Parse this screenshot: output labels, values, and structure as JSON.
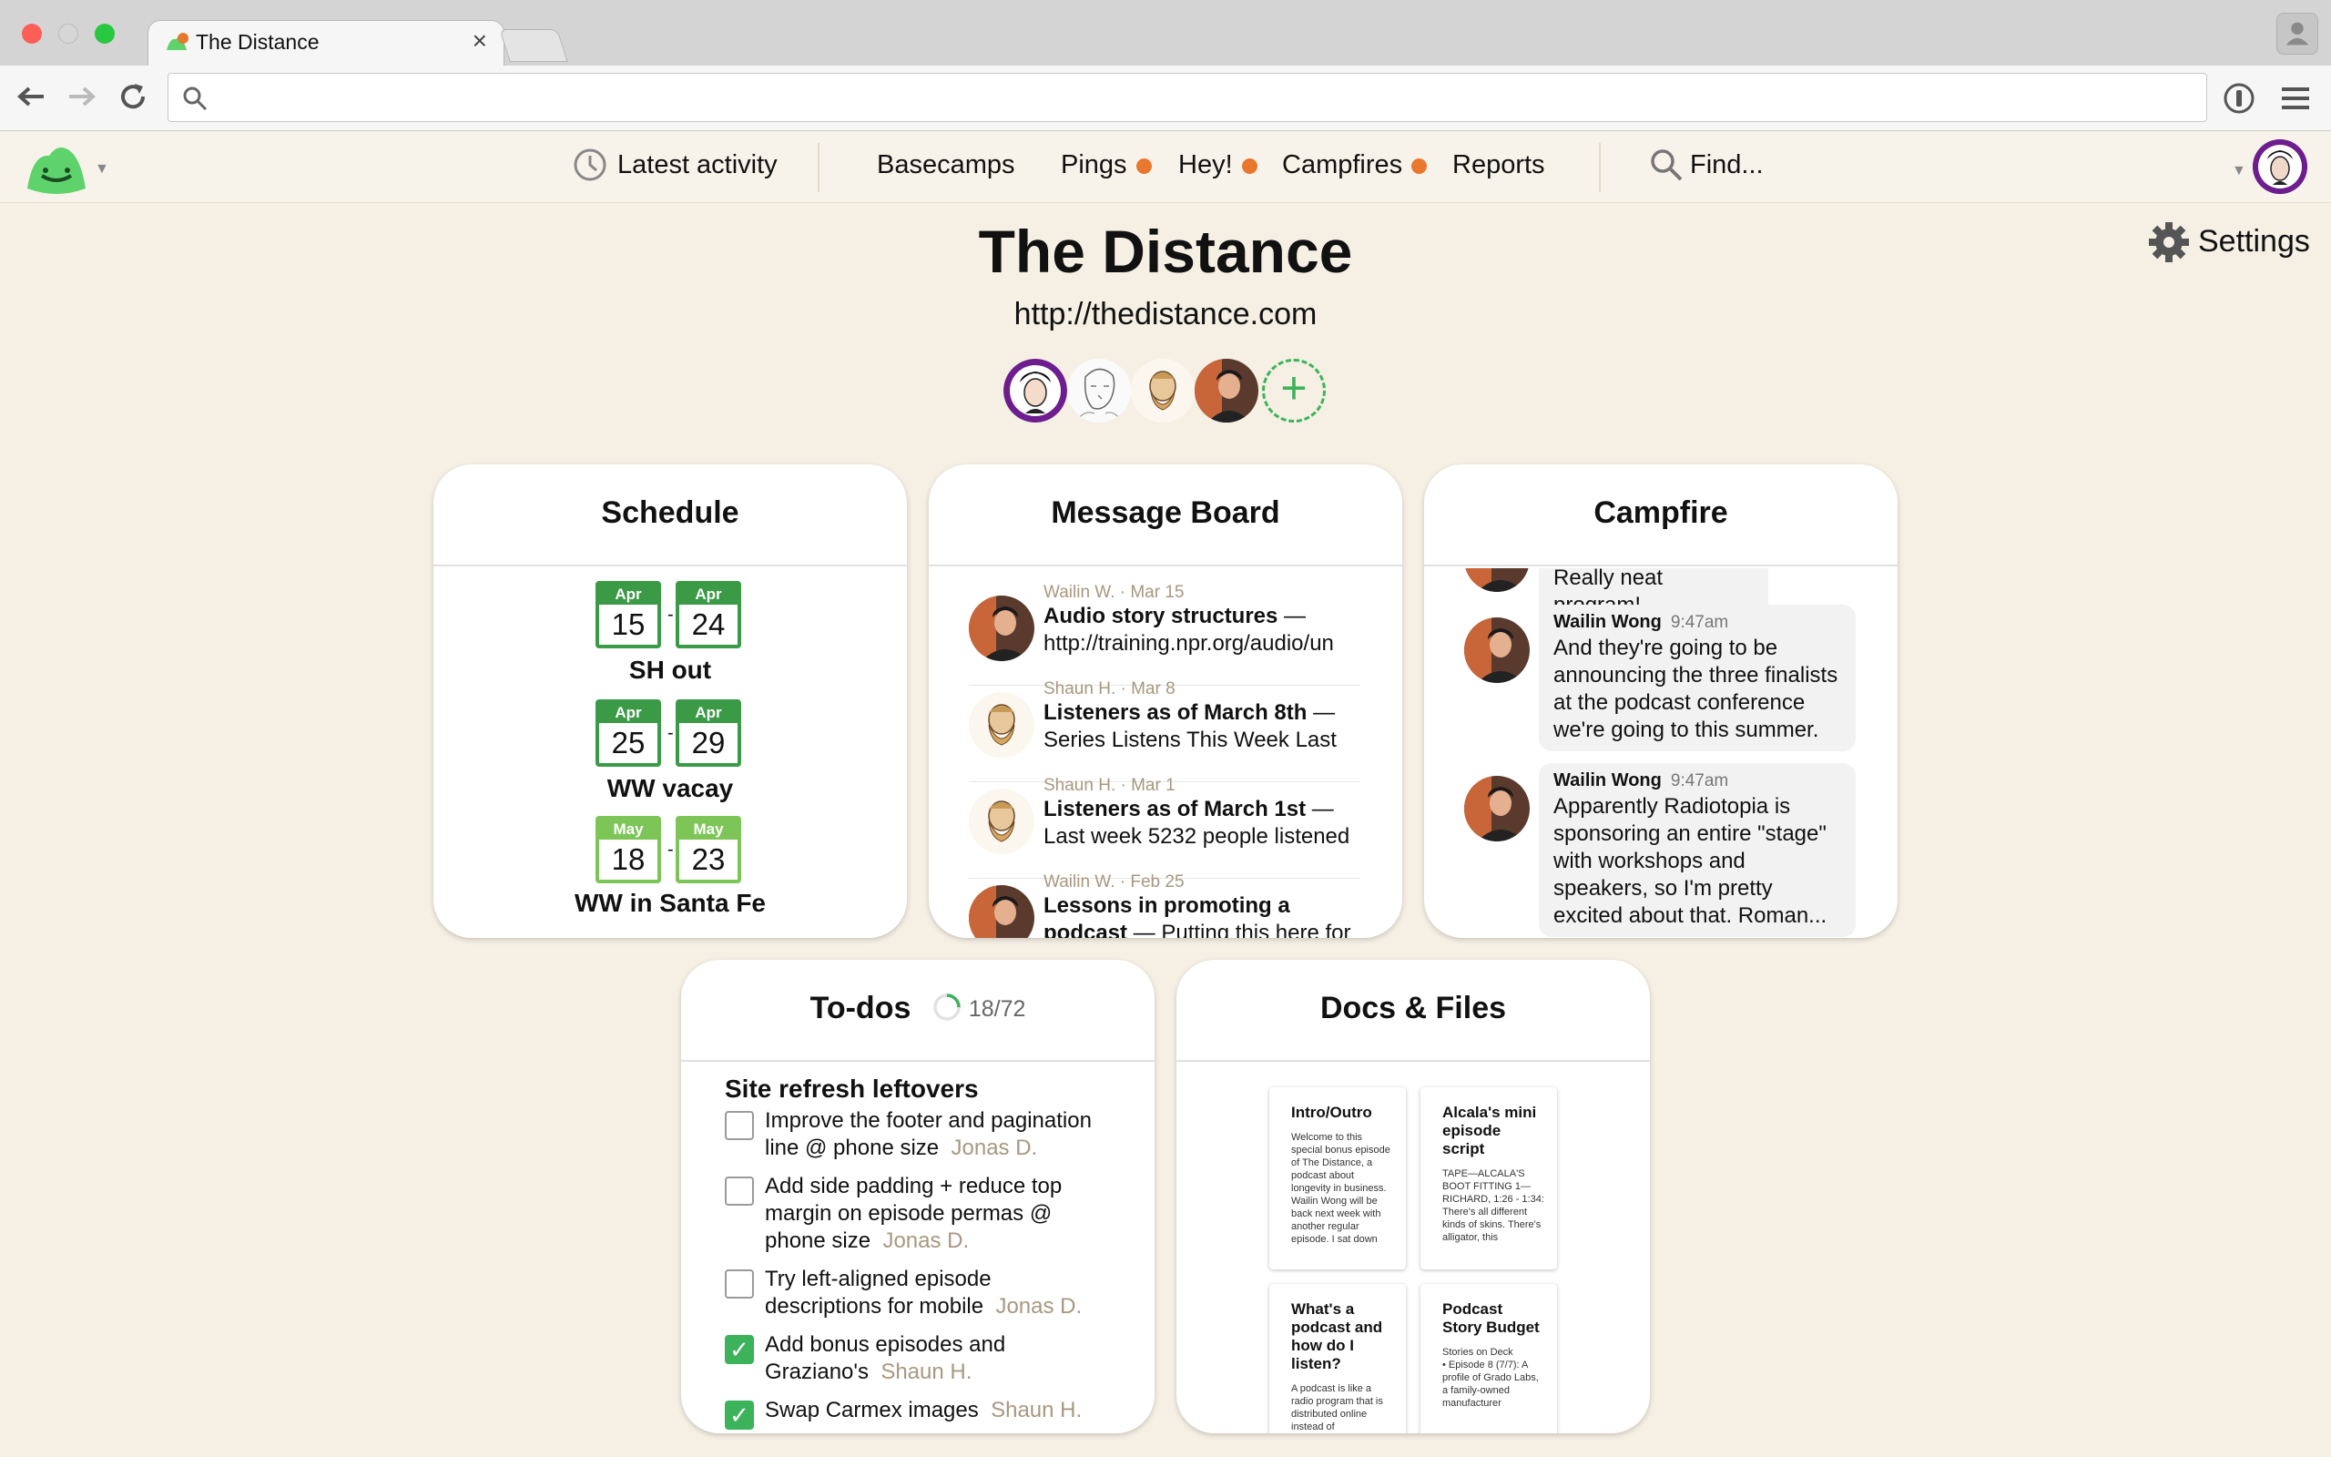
{
  "browser": {
    "tab_title": "The Distance",
    "tab_close": "×",
    "omnibox_value": ""
  },
  "nav": {
    "latest_activity": "Latest activity",
    "basecamps": "Basecamps",
    "pings": "Pings",
    "hey": "Hey!",
    "campfires": "Campfires",
    "reports": "Reports",
    "find": "Find...",
    "notification_dot_color": "#e8782e"
  },
  "settings_label": "Settings",
  "project": {
    "title": "The Distance",
    "url": "http://thedistance.com",
    "add_person": "+"
  },
  "schedule": {
    "title": "Schedule",
    "events": [
      {
        "name": "SH out",
        "start": {
          "month": "Apr",
          "day": "15"
        },
        "end": {
          "month": "Apr",
          "day": "24"
        }
      },
      {
        "name": "WW vacay",
        "start": {
          "month": "Apr",
          "day": "25"
        },
        "end": {
          "month": "Apr",
          "day": "29"
        }
      },
      {
        "name": "WW in Santa Fe",
        "start": {
          "month": "May",
          "day": "18"
        },
        "end": {
          "month": "May",
          "day": "23"
        }
      }
    ],
    "dash": "-"
  },
  "message_board": {
    "title": "Message Board",
    "messages": [
      {
        "meta": "Wailin W. · Mar 15",
        "title": "Audio story structures",
        "sep": " —",
        "excerpt": "http://training.npr.org/audio/un"
      },
      {
        "meta": "Shaun H. · Mar 8",
        "title": "Listeners as of March 8th",
        "sep": " —",
        "excerpt": "Series Listens This Week Last"
      },
      {
        "meta": "Shaun H. · Mar 1",
        "title": "Listeners as of March 1st",
        "sep": " —",
        "excerpt": "Last week 5232 people listened"
      },
      {
        "meta": "Wailin W. · Feb 25",
        "title": "Lessons in promoting a",
        "title2": "podcast",
        "sep": " — Putting this here for"
      }
    ]
  },
  "campfire": {
    "title": "Campfire",
    "partial_line": "Really neat program!",
    "lines": [
      {
        "name": "Wailin Wong",
        "time": "9:47am",
        "text": "And they're going to be announcing the three finalists at the podcast conference we're going to this summer."
      },
      {
        "name": "Wailin Wong",
        "time": "9:47am",
        "text": "Apparently Radiotopia is sponsoring an entire \"stage\" with workshops and speakers, so I'm pretty excited about that. Roman..."
      }
    ]
  },
  "todos": {
    "title": "To-dos",
    "count": "18/72",
    "completed_fraction": 0.25,
    "list_title": "Site refresh leftovers",
    "items": [
      {
        "text": "Improve the footer and pagination line @ phone size",
        "assignee": "Jonas D.",
        "done": false
      },
      {
        "text": "Add side padding + reduce top margin on episode permas @ phone size",
        "assignee": "Jonas D.",
        "done": false
      },
      {
        "text": "Try left-aligned episode descriptions for mobile",
        "assignee": "Jonas D.",
        "done": false
      },
      {
        "text": "Add bonus episodes and Graziano's",
        "assignee": "Shaun H.",
        "done": true
      },
      {
        "text": "Swap Carmex images",
        "assignee": "Shaun H.",
        "done": true
      }
    ],
    "check_mark": "✓"
  },
  "docs": {
    "title": "Docs & Files",
    "items": [
      {
        "title": "Intro/Outro",
        "text": "Welcome to this special bonus episode of The Distance, a podcast about longevity in business. Wailin Wong will be back next week with another regular episode. I sat down"
      },
      {
        "title": "Alcala's mini episode script",
        "text": "TAPE—ALCALA'S BOOT FITTING 1—RICHARD, 1:26 - 1:34: There's all different kinds of skins. There's alligator, this"
      },
      {
        "title": "What's a podcast and how do I listen?",
        "text": "A podcast is like a radio program that is distributed online instead of"
      },
      {
        "title": "Podcast Story Budget",
        "text": "Stories on Deck\n•  Episode 8 (7/7): A profile of Grado Labs, a family-owned manufacturer"
      }
    ]
  },
  "colors": {
    "background": "#f5efe4",
    "green": "#3a9a46",
    "light_green": "#7dc557",
    "check_green": "#3cb35a",
    "meta_tan": "#a8987f"
  }
}
